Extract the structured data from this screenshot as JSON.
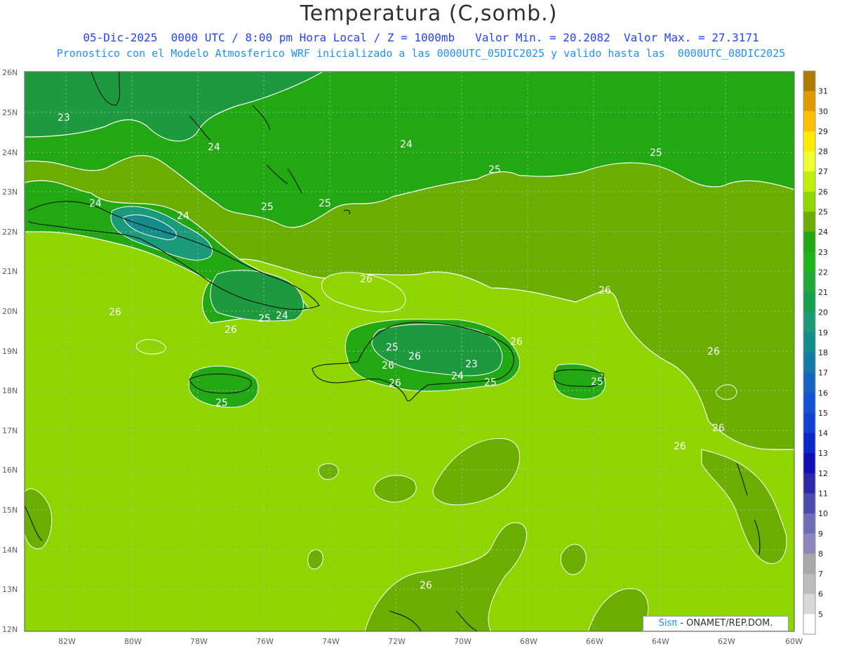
{
  "title": "Temperatura (C,somb.)",
  "subtitle1": "05-Dic-2025  0000 UTC / 8:00 pm Hora Local / Z = 1000mb   Valor Min. = 20.2082  Valor Max. = 27.3171",
  "subtitle2": "Pronostico con el Modelo Atmosferico WRF inicializado a las 0000UTC_05DIC2025 y valido hasta las  0000UTC_08DIC2025",
  "credit": {
    "brand": "Sisπ",
    "text": " - ONAMET/REP.DOM."
  },
  "axes": {
    "lat_labels": [
      "26N",
      "25N",
      "24N",
      "23N",
      "22N",
      "21N",
      "20N",
      "19N",
      "18N",
      "17N",
      "16N",
      "15N",
      "14N",
      "13N",
      "12N"
    ],
    "lon_labels": [
      "82W",
      "80W",
      "78W",
      "76W",
      "74W",
      "72W",
      "70W",
      "68W",
      "66W",
      "64W",
      "62W",
      "60W"
    ]
  },
  "colorbar": {
    "labels": [
      "31",
      "30",
      "29",
      "28",
      "27",
      "26",
      "25",
      "24",
      "23",
      "22",
      "21",
      "20",
      "19",
      "18",
      "17",
      "16",
      "15",
      "14",
      "13",
      "12",
      "11",
      "10",
      "9",
      "8",
      "7",
      "6",
      "5"
    ],
    "colors": [
      "#b07a00",
      "#e09a00",
      "#ffc000",
      "#ffea00",
      "#f0ff30",
      "#bff00c",
      "#8fd600",
      "#6aaf00",
      "#21a812",
      "#1eb41e",
      "#20a838",
      "#15a050",
      "#1a9a78",
      "#138c8c",
      "#1478a8",
      "#1464c0",
      "#1452d2",
      "#1240d0",
      "#0c28c8",
      "#1010b0",
      "#2a2aa8",
      "#4a4ab0",
      "#6e6eb8",
      "#8c86bc",
      "#a8a8a8",
      "#bcbcbc",
      "#d8d8d8",
      "#ffffff"
    ]
  },
  "contour_labels": [
    "23",
    "24",
    "24",
    "24",
    "24",
    "25",
    "25",
    "25",
    "25",
    "26",
    "26",
    "26",
    "26",
    "26",
    "26",
    "26",
    "26",
    "26",
    "25",
    "25",
    "24",
    "23",
    "25",
    "26",
    "24",
    "25",
    "26",
    "26",
    "25"
  ],
  "colors": {
    "c24": "#1ea51e",
    "c25": "#6aaf00",
    "c26": "#8fd600",
    "c23": "#1e9a3e",
    "c22": "#199a50"
  }
}
